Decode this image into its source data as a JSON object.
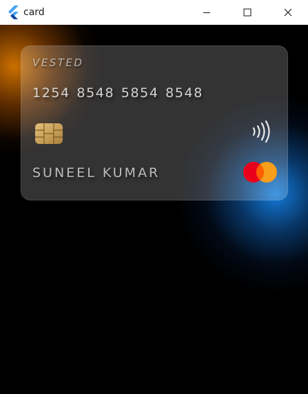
{
  "window": {
    "title": "card",
    "controls": {
      "minimize": "minimize-icon",
      "maximize": "maximize-icon",
      "close": "close-icon"
    }
  },
  "card": {
    "brand_label": "VESTED",
    "number": "1254 8548 5854 8548",
    "holder_name": "SUNEEL KUMAR",
    "network": "mastercard-logo",
    "chip": "chip-icon",
    "contactless": "contactless-icon"
  },
  "colors": {
    "background": "#000000",
    "glow_orange": "#d67600",
    "glow_blue": "#1482e6",
    "mastercard_red": "#eb001b",
    "mastercard_orange": "#f79e1b",
    "chip_gold": "#c9a25c"
  }
}
